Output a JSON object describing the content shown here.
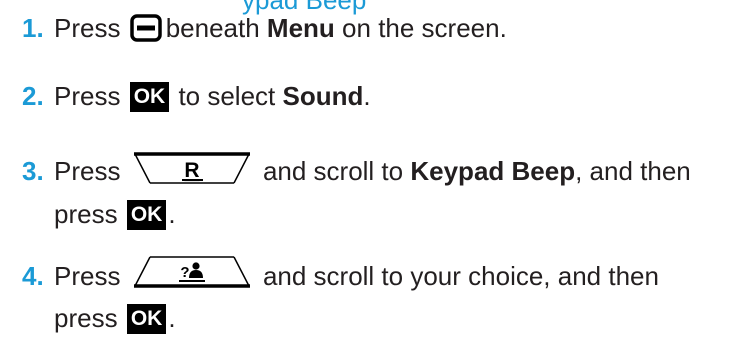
{
  "header_fragment": "ypad Beep",
  "steps": [
    {
      "number": "1.",
      "text_before": "Press",
      "key_icon": "menu-softkey-icon",
      "text_after": "beneath",
      "bold": "Menu",
      "text_end": "on the screen."
    },
    {
      "number": "2.",
      "text_before": "Press",
      "key_icon": "ok-key-icon",
      "ok_label": "OK",
      "text_after": "to select",
      "bold": "Sound",
      "text_end": "."
    },
    {
      "number": "3.",
      "text_before": "Press",
      "key_icon": "redial-key-icon",
      "key_label": "R",
      "text_after": "and scroll to",
      "bold": "Keypad Beep",
      "text_end": ", and then",
      "cont_text": "press",
      "ok_label": "OK",
      "cont_end": "."
    },
    {
      "number": "4.",
      "text_before": "Press",
      "key_icon": "phonebook-key-icon",
      "text_after": "and scroll to your choice, and then",
      "cont_text": "press",
      "ok_label": "OK",
      "cont_end": "."
    }
  ],
  "colors": {
    "accent": "#1b9ad6",
    "text": "#231f20",
    "key_bg": "#000000"
  }
}
